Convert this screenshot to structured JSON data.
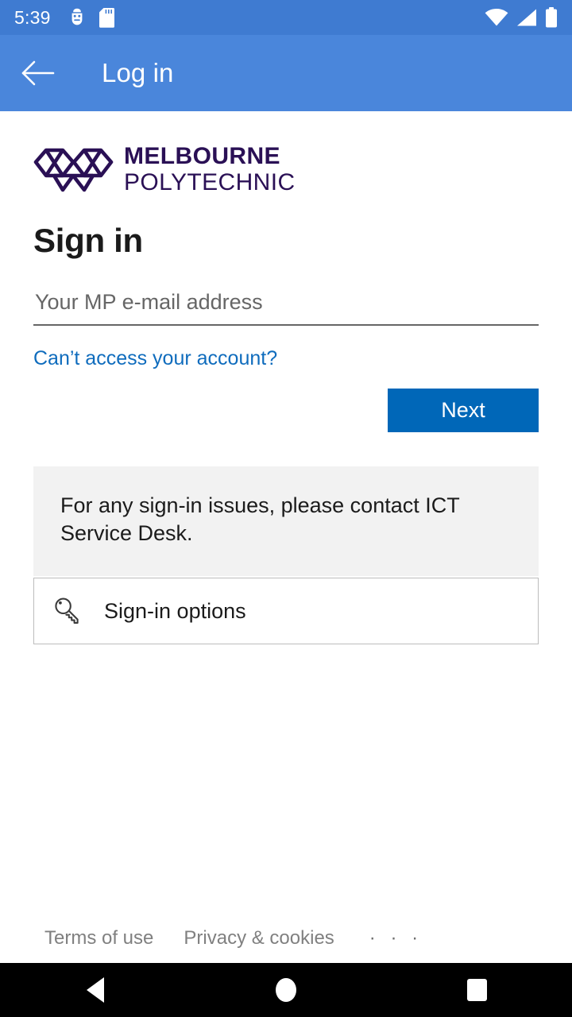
{
  "status_bar": {
    "time": "5:39",
    "icons_left": [
      "android-debug-icon",
      "sd-card-icon"
    ],
    "icons_right": [
      "wifi-icon",
      "cellular-signal-icon",
      "battery-icon"
    ],
    "background_color": "#3f7bd1"
  },
  "app_bar": {
    "title": "Log in",
    "back_icon": "arrow-left-icon",
    "background_color": "#4a86db",
    "text_color": "#ffffff"
  },
  "brand": {
    "line1": "MELBOURNE",
    "line2": "POLYTECHNIC",
    "logo_icon": "melbourne-polytechnic-logo-mark",
    "color": "#2a1055"
  },
  "form": {
    "heading": "Sign in",
    "email_placeholder": "Your MP e-mail address",
    "email_value": "",
    "help_link": "Can’t access your account?",
    "help_link_color": "#0f6cbd",
    "next_label": "Next",
    "next_button_color": "#0067b8"
  },
  "info": {
    "message": "For any sign-in issues, please contact ICT Service Desk.",
    "background_color": "#f2f2f2"
  },
  "signin_options": {
    "label": "Sign-in options",
    "icon": "key-icon"
  },
  "footer": {
    "terms_label": "Terms of use",
    "privacy_label": "Privacy & cookies",
    "more_label": "· · ·",
    "text_color": "#808080"
  },
  "nav_bar": {
    "back": "back-triangle-icon",
    "home": "home-circle-icon",
    "recents": "recents-square-icon",
    "background_color": "#000000"
  }
}
